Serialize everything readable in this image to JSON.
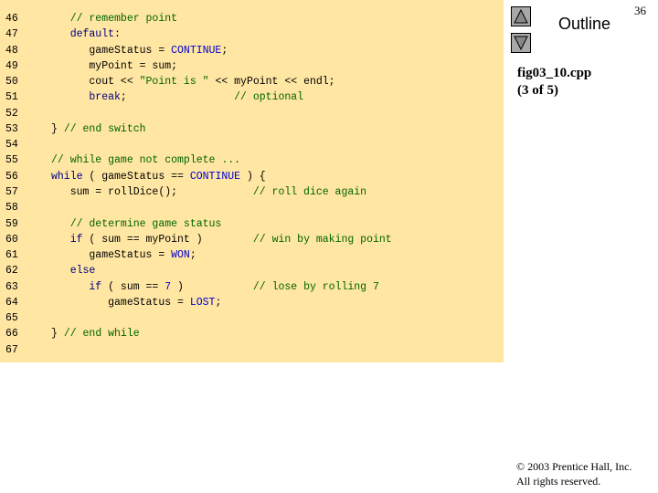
{
  "slide_number": "36",
  "outline": {
    "label": "Outline",
    "up_icon": "triangle-up",
    "down_icon": "triangle-down"
  },
  "caption": {
    "file": "fig03_10.cpp",
    "part": "(3 of 5)"
  },
  "copyright": {
    "line1": "© 2003 Prentice Hall, Inc.",
    "line2": "All rights reserved."
  },
  "colors": {
    "code_background": "#ffe6a3",
    "keyword": "#000080",
    "comment": "#006400",
    "constant": "#0000cc"
  },
  "code": [
    {
      "n": "46",
      "tokens": [
        [
          "comment",
          "   // remember point"
        ]
      ]
    },
    {
      "n": "47",
      "tokens": [
        [
          "kw",
          "   default"
        ],
        [
          "plain",
          ":"
        ]
      ]
    },
    {
      "n": "48",
      "tokens": [
        [
          "plain",
          "      gameStatus = "
        ],
        [
          "const",
          "CONTINUE"
        ],
        [
          "plain",
          ";"
        ]
      ]
    },
    {
      "n": "49",
      "tokens": [
        [
          "plain",
          "      myPoint = sum;"
        ]
      ]
    },
    {
      "n": "50",
      "tokens": [
        [
          "plain",
          "      cout << "
        ],
        [
          "str",
          "\"Point is \""
        ],
        [
          "plain",
          " << myPoint << endl;"
        ]
      ]
    },
    {
      "n": "51",
      "tokens": [
        [
          "kw",
          "      break"
        ],
        [
          "plain",
          ";                 "
        ],
        [
          "comment",
          "// optional"
        ]
      ]
    },
    {
      "n": "52",
      "tokens": []
    },
    {
      "n": "53",
      "tokens": [
        [
          "plain",
          "} "
        ],
        [
          "comment",
          "// end switch"
        ]
      ]
    },
    {
      "n": "54",
      "tokens": []
    },
    {
      "n": "55",
      "tokens": [
        [
          "comment",
          "// while game not complete ..."
        ]
      ]
    },
    {
      "n": "56",
      "tokens": [
        [
          "kw",
          "while"
        ],
        [
          "plain",
          " ( gameStatus == "
        ],
        [
          "const",
          "CONTINUE"
        ],
        [
          "plain",
          " ) {"
        ]
      ]
    },
    {
      "n": "57",
      "tokens": [
        [
          "plain",
          "   sum = rollDice();            "
        ],
        [
          "comment",
          "// roll dice again"
        ]
      ]
    },
    {
      "n": "58",
      "tokens": []
    },
    {
      "n": "59",
      "tokens": [
        [
          "comment",
          "   // determine game status"
        ]
      ]
    },
    {
      "n": "60",
      "tokens": [
        [
          "kw",
          "   if"
        ],
        [
          "plain",
          " ( sum == myPoint )        "
        ],
        [
          "comment",
          "// win by making point"
        ]
      ]
    },
    {
      "n": "61",
      "tokens": [
        [
          "plain",
          "      gameStatus = "
        ],
        [
          "const",
          "WON"
        ],
        [
          "plain",
          ";"
        ]
      ]
    },
    {
      "n": "62",
      "tokens": [
        [
          "kw",
          "   else"
        ]
      ]
    },
    {
      "n": "63",
      "tokens": [
        [
          "kw",
          "      if"
        ],
        [
          "plain",
          " ( sum == "
        ],
        [
          "const",
          "7"
        ],
        [
          "plain",
          " )           "
        ],
        [
          "comment",
          "// lose by rolling 7"
        ]
      ]
    },
    {
      "n": "64",
      "tokens": [
        [
          "plain",
          "         gameStatus = "
        ],
        [
          "const",
          "LOST"
        ],
        [
          "plain",
          ";"
        ]
      ]
    },
    {
      "n": "65",
      "tokens": []
    },
    {
      "n": "66",
      "tokens": [
        [
          "plain",
          "} "
        ],
        [
          "comment",
          "// end while"
        ]
      ]
    },
    {
      "n": "67",
      "tokens": []
    }
  ]
}
